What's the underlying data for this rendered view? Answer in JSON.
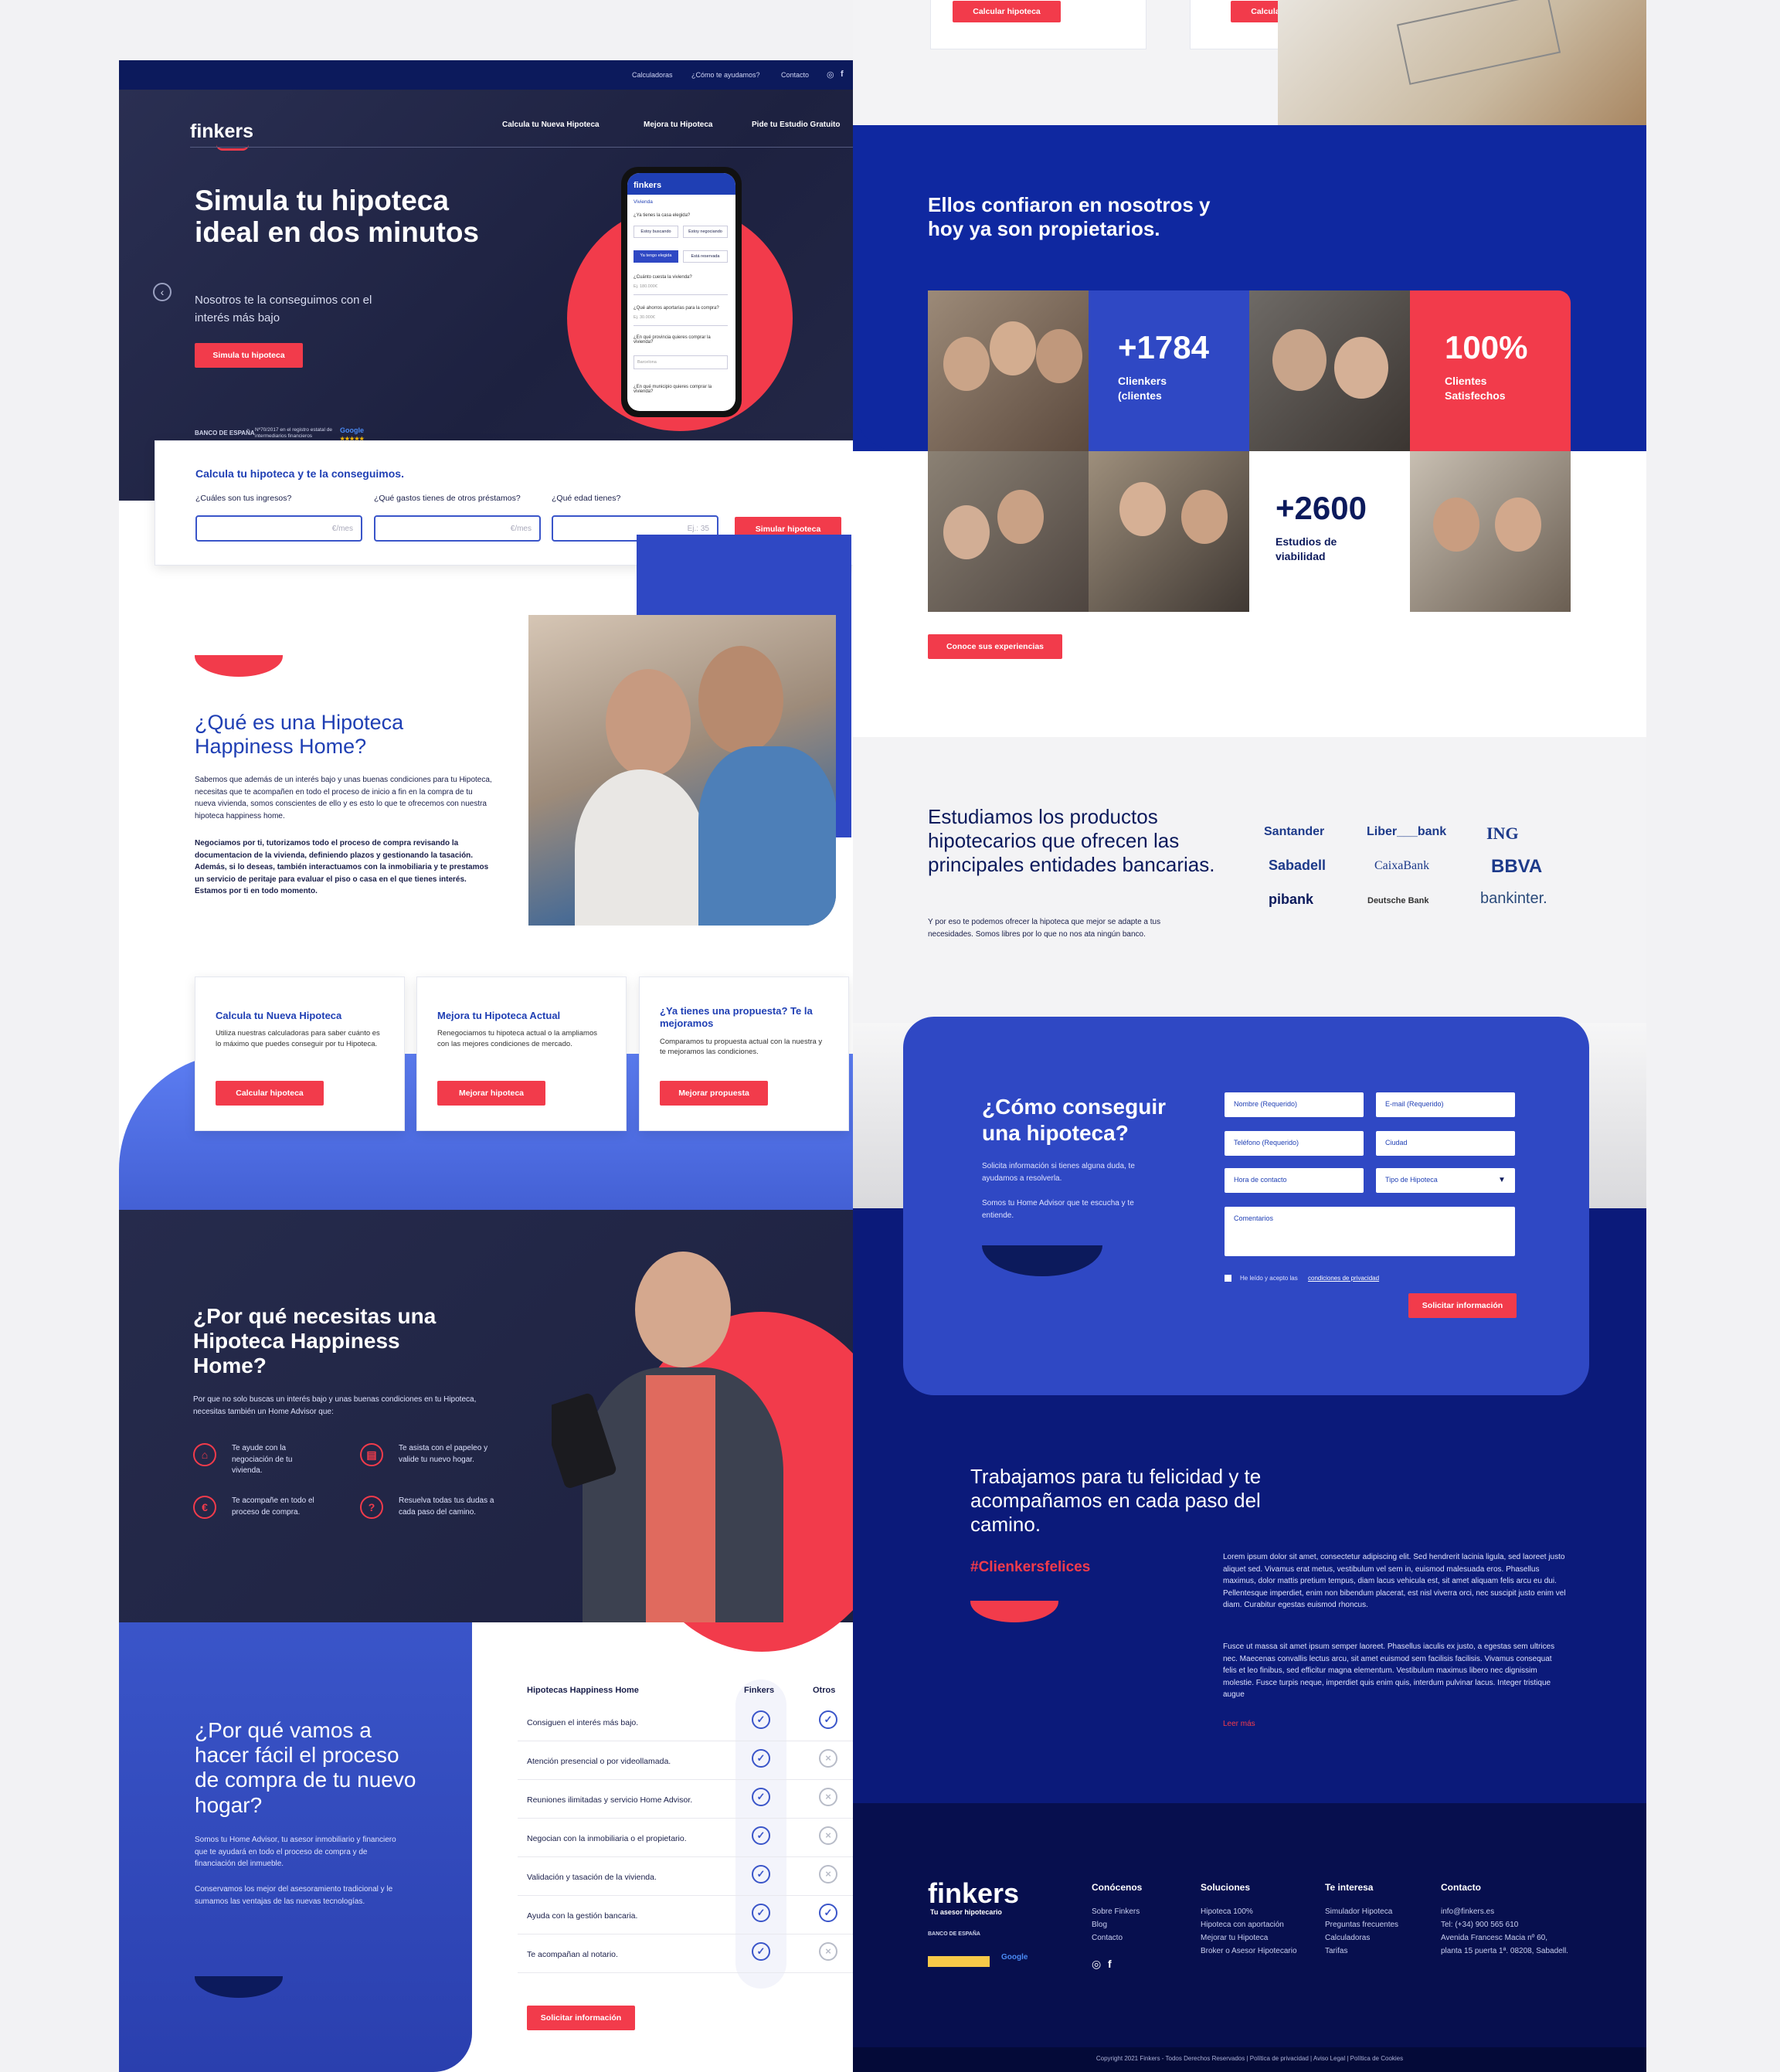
{
  "nav": {
    "top_links": [
      "Calculadoras",
      "¿Cómo te ayudamos?",
      "Contacto"
    ],
    "logo": "finkers",
    "main_links": [
      "Calcula tu Nueva Hipoteca",
      "Mejora tu Hipoteca",
      "Pide tu Estudio Gratuito"
    ]
  },
  "hero": {
    "title": "Simula tu hipoteca ideal en dos minutos",
    "subtitle": "Nosotros te la conseguimos con el interés más bajo",
    "button": "Simula tu hipoteca",
    "badge_text": "Nº70/2017 en el registro estatal de intermediarios financieros",
    "phone": {
      "logo": "finkers",
      "step": "Vivienda",
      "q1": "¿Ya tienes la casa elegida?",
      "opts": [
        "Estoy buscando",
        "Estoy negociando",
        "Ya tengo elegida",
        "Está reservada"
      ],
      "q2": "¿Cuánto cuesta la vivienda?",
      "v2": "Ej. 180.000€",
      "q3": "¿Qué ahorros aportarías para la compra?",
      "v3": "Ej. 30.000€",
      "q4": "¿En qué provincia quieres comprar la vivienda?",
      "v4": "Barcelona",
      "q5": "¿En qué municipio quieres comprar la vivienda?"
    }
  },
  "calc": {
    "title": "Calcula tu hipoteca y te la conseguimos.",
    "labels": [
      "¿Cuáles son tus ingresos?",
      "¿Qué gastos tienes de otros préstamos?",
      "¿Qué edad tienes?"
    ],
    "placeholders": [
      "€/mes",
      "€/mes",
      "Ej.: 35"
    ],
    "button": "Simular hipoteca"
  },
  "what": {
    "title": "¿Qué es una Hipoteca Happiness Home?",
    "p1": "Sabemos que además de un interés bajo y unas buenas condiciones para tu Hipoteca, necesitas que te acompañen en todo el proceso de inicio a fin en la compra de tu nueva vivienda, somos conscientes de ello y es esto lo que te ofrecemos con nuestra hipoteca happiness home.",
    "p2": "Negociamos por ti, tutorizamos todo el proceso de compra revisando la documentacion de la vivienda, definiendo plazos y gestionando la tasación. Además, si lo deseas, también interactuamos con la inmobiliaria y te prestamos un servicio de peritaje para evaluar el piso o casa en el que tienes interés. Estamos por ti en todo momento."
  },
  "services": [
    {
      "title": "Calcula tu Nueva Hipoteca",
      "text": "Utiliza nuestras calculadoras para saber cuánto es lo máximo que puedes conseguir por tu Hipoteca.",
      "button": "Calcular hipoteca"
    },
    {
      "title": "Mejora tu Hipoteca Actual",
      "text": "Renegociamos tu hipoteca actual o la ampliamos con las mejores condiciones de mercado.",
      "button": "Mejorar hipoteca"
    },
    {
      "title": "¿Ya tienes una propuesta? Te la mejoramos",
      "text": "Comparamos tu propuesta actual con la nuestra y te mejoramos las condiciones.",
      "button": "Mejorar propuesta"
    }
  ],
  "why": {
    "title": "¿Por qué necesitas una Hipoteca Happiness Home?",
    "text": "Por que no solo buscas un interés bajo y unas buenas condiciones en tu Hipoteca, necesitas también un Home Advisor que:",
    "features": [
      {
        "icon": "house-icon",
        "text": "Te ayude con la negociación de tu vivienda."
      },
      {
        "icon": "document-icon",
        "text": "Te asista con el papeleo y valide tu nuevo hogar."
      },
      {
        "icon": "euro-icon",
        "text": "Te acompañe en todo el proceso de compra."
      },
      {
        "icon": "question-icon",
        "text": "Resuelva todas tus dudas a cada paso del camino."
      }
    ]
  },
  "easy": {
    "title": "¿Por qué vamos a hacer fácil el proceso de compra de tu nuevo hogar?",
    "p1": "Somos tu Home Advisor, tu asesor inmobiliario y financiero que te ayudará en todo el proceso de compra y de financiación del inmueble.",
    "p2": "Conservamos los mejor del asesoramiento tradicional y le sumamos las ventajas de las nuevas tecnologías."
  },
  "compare": {
    "headers": [
      "Hipotecas Happiness Home",
      "Finkers",
      "Otros"
    ],
    "rows": [
      {
        "label": "Consiguen el interés más bajo.",
        "finkers": true,
        "otros": true
      },
      {
        "label": "Atención presencial o por videollamada.",
        "finkers": true,
        "otros": false
      },
      {
        "label": "Reuniones ilimitadas y servicio Home Advisor.",
        "finkers": true,
        "otros": false
      },
      {
        "label": "Negocian con la inmobiliaria o el propietario.",
        "finkers": true,
        "otros": false
      },
      {
        "label": "Validación y tasación de la vivienda.",
        "finkers": true,
        "otros": false
      },
      {
        "label": "Ayuda con la gestión bancaria.",
        "finkers": true,
        "otros": true
      },
      {
        "label": "Te acompañan al notario.",
        "finkers": true,
        "otros": false
      }
    ],
    "button": "Solicitar información"
  },
  "top_right": {
    "buttons": [
      "Calcular hipoteca",
      "Calcular hipoteca"
    ]
  },
  "trust": {
    "title": "Ellos confiaron en nosotros y hoy ya son propietarios.",
    "stats": [
      {
        "num": "+1784",
        "label": "Clienkers (clientes"
      },
      {
        "num": "100%",
        "label": "Clientes Satisfechos"
      },
      {
        "num": "+2600",
        "label": "Estudios de viabilidad"
      }
    ],
    "button": "Conoce sus experiencias"
  },
  "banks": {
    "title": "Estudiamos los productos hipotecarios que ofrecen las principales entidades bancarias.",
    "text": "Y por eso te podemos ofrecer la hipoteca que mejor se adapte a tus necesidades. Somos libres por lo que no nos ata ningún banco.",
    "logos": [
      "Santander",
      "Liber___bank",
      "ING",
      "Sabadell",
      "CaixaBank",
      "BBVA",
      "pibank",
      "Deutsche Bank",
      "bankinter."
    ]
  },
  "form": {
    "title": "¿Cómo conseguir una hipoteca?",
    "p1": "Solicita información si tienes alguna duda, te ayudamos a resolverla.",
    "p2": "Somos tu Home Advisor que te escucha y te entiende.",
    "fields": [
      "Nombre (Requerido)",
      "E-mail (Requerido)",
      "Teléfono (Requerido)",
      "Ciudad",
      "Hora de contacto",
      "Tipo de Hipoteca",
      "Comentarios"
    ],
    "consent": "He leído y acepto las",
    "consent_link": "condiciones de privacidad",
    "button": "Solicitar información"
  },
  "happy": {
    "title": "Trabajamos para tu felicidad y te acompañamos en cada paso del camino.",
    "hashtag": "#Clienkersfelices",
    "p1": "Lorem ipsum dolor sit amet, consectetur adipiscing elit. Sed hendrerit lacinia ligula, sed laoreet justo aliquet sed. Vivamus erat metus, vestibulum vel sem in, euismod malesuada eros. Phasellus maximus, dolor mattis pretium tempus, diam lacus vehicula est, sit amet aliquam felis arcu eu dui. Pellentesque imperdiet, enim non bibendum placerat, est nisl viverra orci, nec suscipit justo enim vel diam. Curabitur egestas euismod rhoncus.",
    "p2": "Fusce ut massa sit amet ipsum semper laoreet. Phasellus iaculis ex justo, a egestas sem ultrices nec. Maecenas convallis lectus arcu, sit amet euismod sem facilisis facilisis. Vivamus consequat felis et leo finibus, sed efficitur magna elementum. Vestibulum maximus libero nec dignissim molestie. Fusce turpis neque, imperdiet quis enim quis, interdum pulvinar lacus. Integer tristique augue",
    "more": "Leer más"
  },
  "footer": {
    "logo": "finkers",
    "tagline": "Tu asesor hipotecario",
    "cols": [
      {
        "title": "Conócenos",
        "items": [
          "Sobre Finkers",
          "Blog",
          "Contacto"
        ]
      },
      {
        "title": "Soluciones",
        "items": [
          "Hipoteca 100%",
          "Hipoteca con aportación",
          "Mejorar tu Hipoteca",
          "Broker o Asesor Hipotecario"
        ]
      },
      {
        "title": "Te interesa",
        "items": [
          "Simulador Hipoteca",
          "Preguntas frecuentes",
          "Calculadoras",
          "Tarifas"
        ]
      },
      {
        "title": "Contacto",
        "items": [
          "info@finkers.es",
          "Tel: (+34) 900 565 610",
          "Avenida Francesc Macia nº 60,",
          "planta 15 puerta 1ª. 08208, Sabadell."
        ]
      }
    ],
    "copyright": "Copyright 2021 Finkers - Todos Derechos Reservados | Política de privacidad | Aviso Legal | Política de Cookies"
  },
  "colors": {
    "navy": "#0c1a5c",
    "blue": "#2f48c4",
    "red": "#f23b4b",
    "dark": "#1d2140"
  }
}
